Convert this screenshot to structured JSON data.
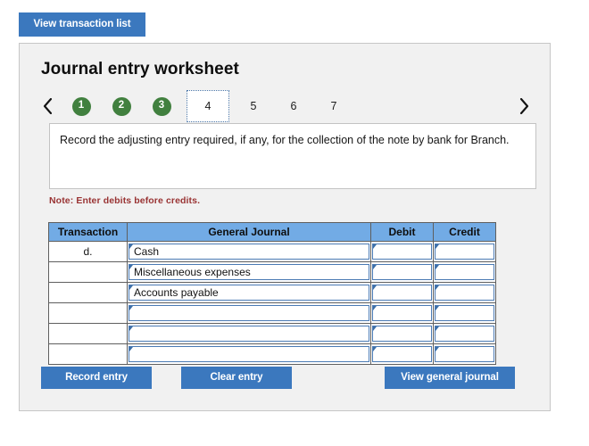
{
  "toolbar": {
    "view_transaction_list_label": "View transaction list"
  },
  "panel": {
    "title": "Journal entry worksheet",
    "nav": {
      "prev_icon": "chevron-left-icon",
      "next_icon": "chevron-right-icon",
      "tabs": [
        {
          "label": "1",
          "state": "completed"
        },
        {
          "label": "2",
          "state": "completed"
        },
        {
          "label": "3",
          "state": "completed"
        },
        {
          "label": "4",
          "state": "active"
        },
        {
          "label": "5",
          "state": "pending"
        },
        {
          "label": "6",
          "state": "pending"
        },
        {
          "label": "7",
          "state": "pending"
        }
      ]
    },
    "instruction": "Record the adjusting entry required, if any, for the collection of the note by bank for Branch.",
    "note": "Note: Enter debits before credits.",
    "table": {
      "headers": [
        "Transaction",
        "General Journal",
        "Debit",
        "Credit"
      ],
      "rows": [
        {
          "transaction": "d.",
          "general_journal": "Cash",
          "debit": "",
          "credit": ""
        },
        {
          "transaction": "",
          "general_journal": "Miscellaneous expenses",
          "debit": "",
          "credit": ""
        },
        {
          "transaction": "",
          "general_journal": "Accounts payable",
          "debit": "",
          "credit": ""
        },
        {
          "transaction": "",
          "general_journal": "",
          "debit": "",
          "credit": ""
        },
        {
          "transaction": "",
          "general_journal": "",
          "debit": "",
          "credit": ""
        },
        {
          "transaction": "",
          "general_journal": "",
          "debit": "",
          "credit": ""
        }
      ]
    },
    "actions": {
      "record_entry_label": "Record entry",
      "clear_entry_label": "Clear entry",
      "view_general_journal_label": "View general journal"
    }
  },
  "colors": {
    "button_blue": "#3b78be",
    "header_blue": "#72abe5",
    "completed_green": "#41803f",
    "note_red": "#993333",
    "panel_bg": "#f1f1f1",
    "input_border_blue": "#4a7ab4"
  }
}
